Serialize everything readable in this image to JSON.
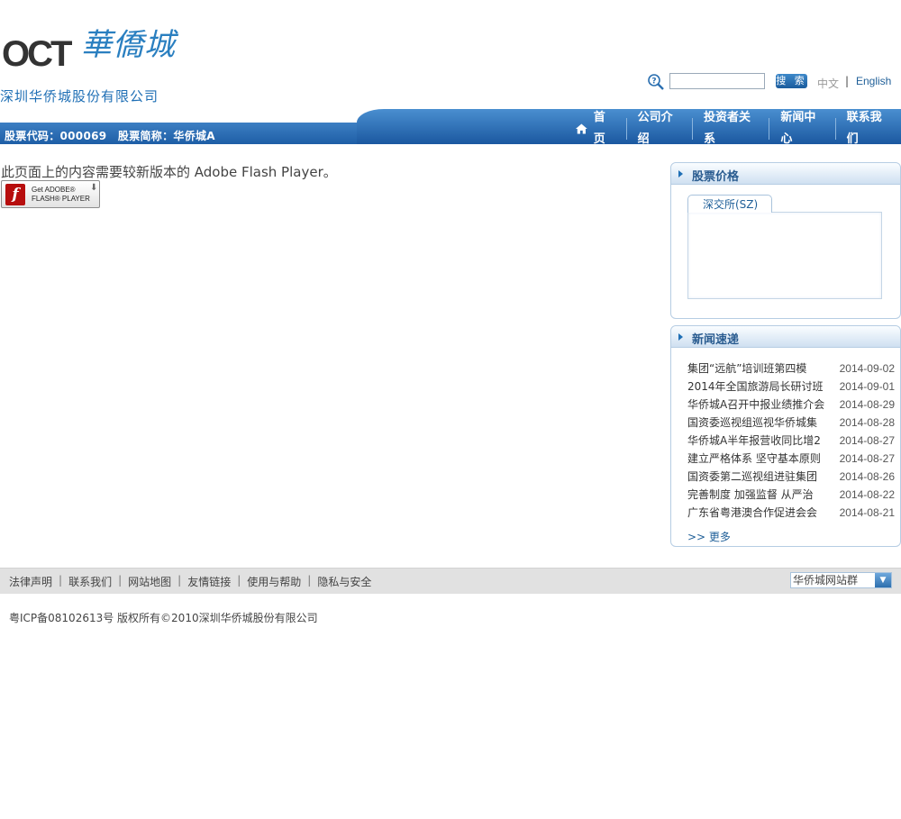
{
  "logo": {
    "oct": "OCT",
    "chinese": "華僑城",
    "company_name": "深圳华侨城股份有限公司"
  },
  "search": {
    "placeholder": "",
    "button_label": "搜 索"
  },
  "language": {
    "chinese": "中文",
    "separator": "|",
    "english": "English"
  },
  "stock_info": {
    "code": "股票代码：000069",
    "short_name": "股票简称：华侨城A"
  },
  "nav": {
    "items": [
      "首页",
      "公司介绍",
      "投资者关系",
      "新闻中心",
      "联系我们"
    ]
  },
  "flash": {
    "message": "此页面上的内容需要较新版本的 Adobe Flash Player。",
    "button_get": "Get ADOBE®",
    "button_product": "FLASH® PLAYER",
    "logo_letter": "f"
  },
  "stock_panel": {
    "title": "股票价格",
    "tab": "深交所(SZ)"
  },
  "news_panel": {
    "title": "新闻速递",
    "items": [
      {
        "title": "集团“远航”培训班第四模",
        "date": "2014-09-02"
      },
      {
        "title": "2014年全国旅游局长研讨班",
        "date": "2014-09-01"
      },
      {
        "title": "华侨城A召开中报业绩推介会",
        "date": "2014-08-29"
      },
      {
        "title": "国资委巡视组巡视华侨城集",
        "date": "2014-08-28"
      },
      {
        "title": "华侨城A半年报营收同比增2",
        "date": "2014-08-27"
      },
      {
        "title": "建立严格体系 坚守基本原则",
        "date": "2014-08-27"
      },
      {
        "title": "国资委第二巡视组进驻集团",
        "date": "2014-08-26"
      },
      {
        "title": "完善制度 加强监督 从严治",
        "date": "2014-08-22"
      },
      {
        "title": "广东省粤港澳合作促进会会",
        "date": "2014-08-21"
      }
    ],
    "more": ">> 更多"
  },
  "footer": {
    "links": [
      "法律声明",
      "联系我们",
      "网站地图",
      "友情链接",
      "使用与帮助",
      "隐私与安全"
    ],
    "site_group": "华侨城网站群",
    "copyright": "粤ICP备08102613号  版权所有©2010深圳华侨城股份有限公司"
  }
}
